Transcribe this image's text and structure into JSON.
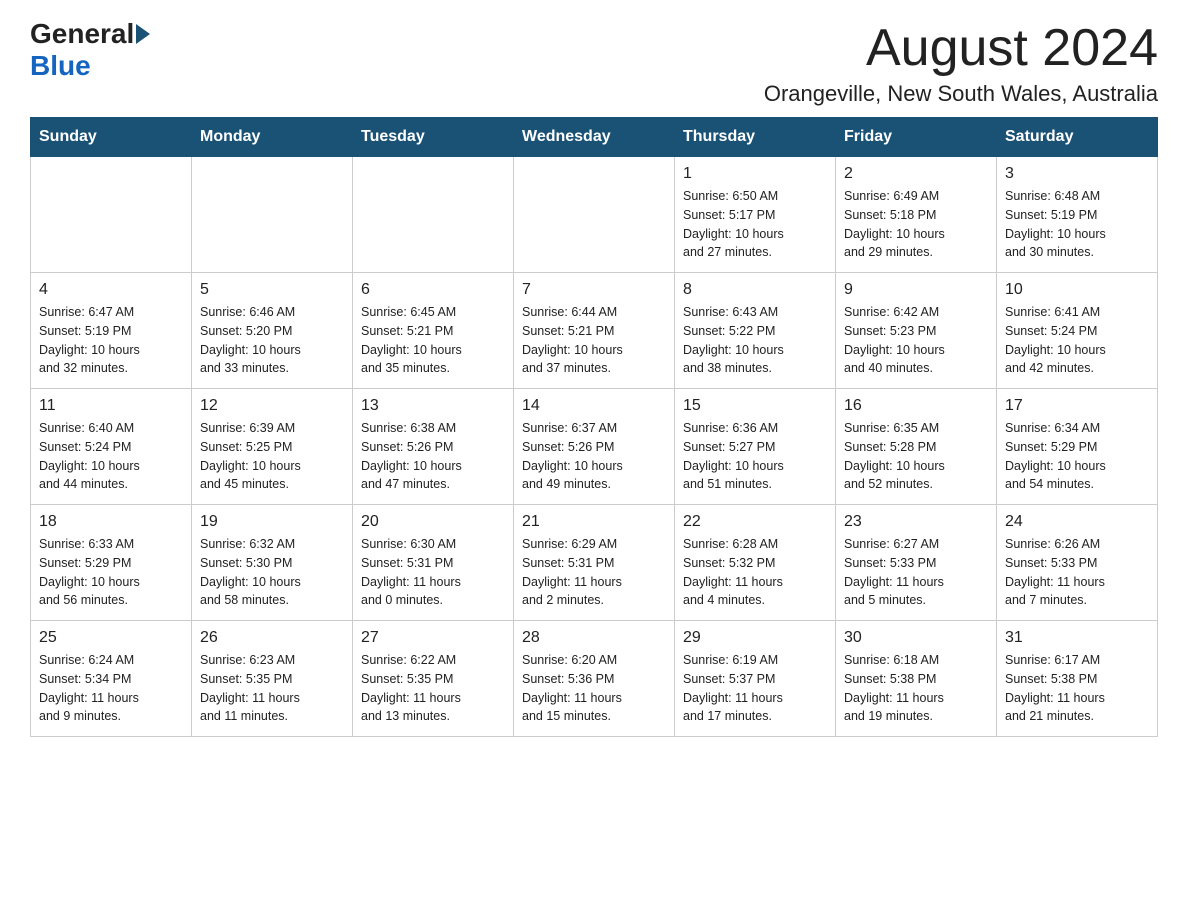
{
  "logo": {
    "general": "General",
    "blue": "Blue"
  },
  "title": "August 2024",
  "location": "Orangeville, New South Wales, Australia",
  "weekdays": [
    "Sunday",
    "Monday",
    "Tuesday",
    "Wednesday",
    "Thursday",
    "Friday",
    "Saturday"
  ],
  "weeks": [
    [
      {
        "day": "",
        "info": ""
      },
      {
        "day": "",
        "info": ""
      },
      {
        "day": "",
        "info": ""
      },
      {
        "day": "",
        "info": ""
      },
      {
        "day": "1",
        "info": "Sunrise: 6:50 AM\nSunset: 5:17 PM\nDaylight: 10 hours\nand 27 minutes."
      },
      {
        "day": "2",
        "info": "Sunrise: 6:49 AM\nSunset: 5:18 PM\nDaylight: 10 hours\nand 29 minutes."
      },
      {
        "day": "3",
        "info": "Sunrise: 6:48 AM\nSunset: 5:19 PM\nDaylight: 10 hours\nand 30 minutes."
      }
    ],
    [
      {
        "day": "4",
        "info": "Sunrise: 6:47 AM\nSunset: 5:19 PM\nDaylight: 10 hours\nand 32 minutes."
      },
      {
        "day": "5",
        "info": "Sunrise: 6:46 AM\nSunset: 5:20 PM\nDaylight: 10 hours\nand 33 minutes."
      },
      {
        "day": "6",
        "info": "Sunrise: 6:45 AM\nSunset: 5:21 PM\nDaylight: 10 hours\nand 35 minutes."
      },
      {
        "day": "7",
        "info": "Sunrise: 6:44 AM\nSunset: 5:21 PM\nDaylight: 10 hours\nand 37 minutes."
      },
      {
        "day": "8",
        "info": "Sunrise: 6:43 AM\nSunset: 5:22 PM\nDaylight: 10 hours\nand 38 minutes."
      },
      {
        "day": "9",
        "info": "Sunrise: 6:42 AM\nSunset: 5:23 PM\nDaylight: 10 hours\nand 40 minutes."
      },
      {
        "day": "10",
        "info": "Sunrise: 6:41 AM\nSunset: 5:24 PM\nDaylight: 10 hours\nand 42 minutes."
      }
    ],
    [
      {
        "day": "11",
        "info": "Sunrise: 6:40 AM\nSunset: 5:24 PM\nDaylight: 10 hours\nand 44 minutes."
      },
      {
        "day": "12",
        "info": "Sunrise: 6:39 AM\nSunset: 5:25 PM\nDaylight: 10 hours\nand 45 minutes."
      },
      {
        "day": "13",
        "info": "Sunrise: 6:38 AM\nSunset: 5:26 PM\nDaylight: 10 hours\nand 47 minutes."
      },
      {
        "day": "14",
        "info": "Sunrise: 6:37 AM\nSunset: 5:26 PM\nDaylight: 10 hours\nand 49 minutes."
      },
      {
        "day": "15",
        "info": "Sunrise: 6:36 AM\nSunset: 5:27 PM\nDaylight: 10 hours\nand 51 minutes."
      },
      {
        "day": "16",
        "info": "Sunrise: 6:35 AM\nSunset: 5:28 PM\nDaylight: 10 hours\nand 52 minutes."
      },
      {
        "day": "17",
        "info": "Sunrise: 6:34 AM\nSunset: 5:29 PM\nDaylight: 10 hours\nand 54 minutes."
      }
    ],
    [
      {
        "day": "18",
        "info": "Sunrise: 6:33 AM\nSunset: 5:29 PM\nDaylight: 10 hours\nand 56 minutes."
      },
      {
        "day": "19",
        "info": "Sunrise: 6:32 AM\nSunset: 5:30 PM\nDaylight: 10 hours\nand 58 minutes."
      },
      {
        "day": "20",
        "info": "Sunrise: 6:30 AM\nSunset: 5:31 PM\nDaylight: 11 hours\nand 0 minutes."
      },
      {
        "day": "21",
        "info": "Sunrise: 6:29 AM\nSunset: 5:31 PM\nDaylight: 11 hours\nand 2 minutes."
      },
      {
        "day": "22",
        "info": "Sunrise: 6:28 AM\nSunset: 5:32 PM\nDaylight: 11 hours\nand 4 minutes."
      },
      {
        "day": "23",
        "info": "Sunrise: 6:27 AM\nSunset: 5:33 PM\nDaylight: 11 hours\nand 5 minutes."
      },
      {
        "day": "24",
        "info": "Sunrise: 6:26 AM\nSunset: 5:33 PM\nDaylight: 11 hours\nand 7 minutes."
      }
    ],
    [
      {
        "day": "25",
        "info": "Sunrise: 6:24 AM\nSunset: 5:34 PM\nDaylight: 11 hours\nand 9 minutes."
      },
      {
        "day": "26",
        "info": "Sunrise: 6:23 AM\nSunset: 5:35 PM\nDaylight: 11 hours\nand 11 minutes."
      },
      {
        "day": "27",
        "info": "Sunrise: 6:22 AM\nSunset: 5:35 PM\nDaylight: 11 hours\nand 13 minutes."
      },
      {
        "day": "28",
        "info": "Sunrise: 6:20 AM\nSunset: 5:36 PM\nDaylight: 11 hours\nand 15 minutes."
      },
      {
        "day": "29",
        "info": "Sunrise: 6:19 AM\nSunset: 5:37 PM\nDaylight: 11 hours\nand 17 minutes."
      },
      {
        "day": "30",
        "info": "Sunrise: 6:18 AM\nSunset: 5:38 PM\nDaylight: 11 hours\nand 19 minutes."
      },
      {
        "day": "31",
        "info": "Sunrise: 6:17 AM\nSunset: 5:38 PM\nDaylight: 11 hours\nand 21 minutes."
      }
    ]
  ]
}
